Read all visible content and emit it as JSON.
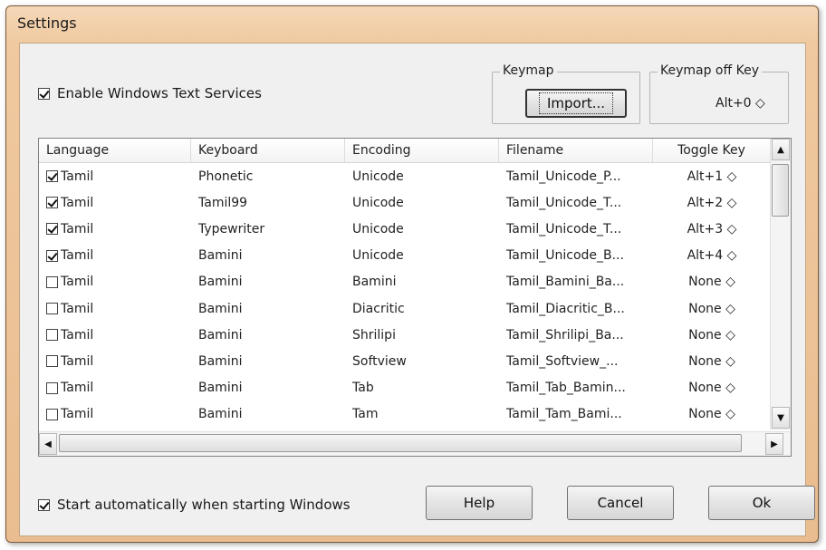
{
  "window": {
    "title": "Settings"
  },
  "enable_services": {
    "label": "Enable Windows Text Services",
    "checked": true
  },
  "keymap": {
    "group_label": "Keymap",
    "import_label": "Import..."
  },
  "keymap_off": {
    "group_label": "Keymap off Key",
    "value": "Alt+0 ◇"
  },
  "table": {
    "columns": [
      "Language",
      "Keyboard",
      "Encoding",
      "Filename",
      "Toggle Key"
    ],
    "rows": [
      {
        "checked": true,
        "language": "Tamil",
        "keyboard": "Phonetic",
        "encoding": "Unicode",
        "filename": "Tamil_Unicode_P...",
        "toggle": "Alt+1 ◇"
      },
      {
        "checked": true,
        "language": "Tamil",
        "keyboard": "Tamil99",
        "encoding": "Unicode",
        "filename": "Tamil_Unicode_T...",
        "toggle": "Alt+2 ◇"
      },
      {
        "checked": true,
        "language": "Tamil",
        "keyboard": "Typewriter",
        "encoding": "Unicode",
        "filename": "Tamil_Unicode_T...",
        "toggle": "Alt+3 ◇"
      },
      {
        "checked": true,
        "language": "Tamil",
        "keyboard": "Bamini",
        "encoding": "Unicode",
        "filename": "Tamil_Unicode_B...",
        "toggle": "Alt+4 ◇"
      },
      {
        "checked": false,
        "language": "Tamil",
        "keyboard": "Bamini",
        "encoding": "Bamini",
        "filename": "Tamil_Bamini_Ba...",
        "toggle": "None ◇"
      },
      {
        "checked": false,
        "language": "Tamil",
        "keyboard": "Bamini",
        "encoding": "Diacritic",
        "filename": "Tamil_Diacritic_B...",
        "toggle": "None ◇"
      },
      {
        "checked": false,
        "language": "Tamil",
        "keyboard": "Bamini",
        "encoding": "Shrilipi",
        "filename": "Tamil_Shrilipi_Ba...",
        "toggle": "None ◇"
      },
      {
        "checked": false,
        "language": "Tamil",
        "keyboard": "Bamini",
        "encoding": "Softview",
        "filename": "Tamil_Softview_...",
        "toggle": "None ◇"
      },
      {
        "checked": false,
        "language": "Tamil",
        "keyboard": "Bamini",
        "encoding": "Tab",
        "filename": "Tamil_Tab_Bamin...",
        "toggle": "None ◇"
      },
      {
        "checked": false,
        "language": "Tamil",
        "keyboard": "Bamini",
        "encoding": "Tam",
        "filename": "Tamil_Tam_Bami...",
        "toggle": "None ◇"
      }
    ]
  },
  "icons": {
    "scroll_up": "▲",
    "scroll_down": "▼",
    "scroll_left": "◀",
    "scroll_right": "▶"
  },
  "autostart": {
    "label": "Start automatically when starting Windows",
    "checked": true
  },
  "buttons": {
    "help": "Help",
    "cancel": "Cancel",
    "ok": "Ok"
  }
}
